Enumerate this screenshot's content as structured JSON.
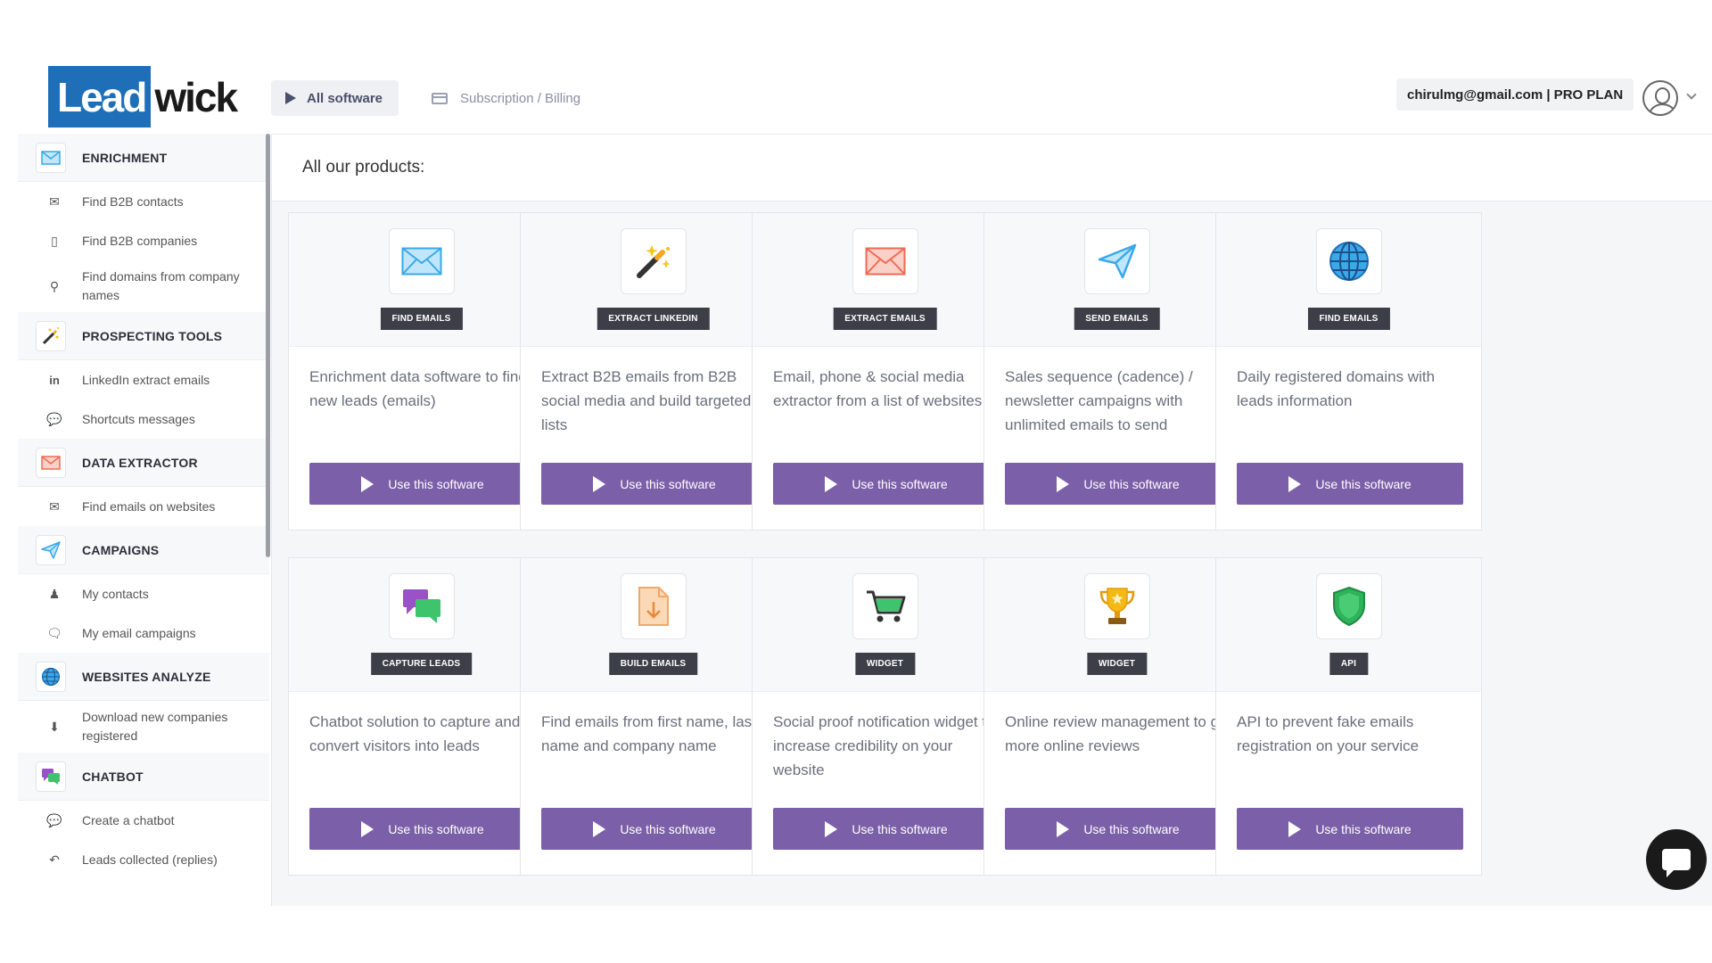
{
  "header": {
    "logo_part1": "Lead",
    "logo_part2": "wick",
    "nav_all_software": "All software",
    "nav_billing": "Subscription / Billing",
    "account_label": "chirulmg@gmail.com | PRO PLAN"
  },
  "sidebar": {
    "sections": [
      {
        "label": "ENRICHMENT",
        "icon": "envelope-icon",
        "items": [
          {
            "label": "Find B2B contacts",
            "icon": "mail-icon"
          },
          {
            "label": "Find B2B companies",
            "icon": "building-icon"
          },
          {
            "label": "Find domains from company names",
            "icon": "search-icon"
          }
        ]
      },
      {
        "label": "PROSPECTING TOOLS",
        "icon": "magic-wand-icon",
        "items": [
          {
            "label": "LinkedIn extract emails",
            "icon": "linkedin-icon"
          },
          {
            "label": "Shortcuts messages",
            "icon": "comment-icon"
          }
        ]
      },
      {
        "label": "DATA EXTRACTOR",
        "icon": "envelope-red-icon",
        "items": [
          {
            "label": "Find emails on websites",
            "icon": "mail-icon"
          }
        ]
      },
      {
        "label": "CAMPAIGNS",
        "icon": "paper-plane-icon",
        "items": [
          {
            "label": "My contacts",
            "icon": "users-icon"
          },
          {
            "label": "My email campaigns",
            "icon": "comments-icon"
          }
        ]
      },
      {
        "label": "WEBSITES ANALYZE",
        "icon": "globe-icon",
        "items": [
          {
            "label": "Download new companies registered",
            "icon": "download-icon"
          }
        ]
      },
      {
        "label": "CHATBOT",
        "icon": "chat-bubbles-icon",
        "items": [
          {
            "label": "Create a chatbot",
            "icon": "comment-icon"
          },
          {
            "label": "Leads collected (replies)",
            "icon": "reply-icon"
          }
        ]
      }
    ]
  },
  "main": {
    "title": "All our products:",
    "button_label": "Use this software",
    "products": [
      {
        "tag": "FIND EMAILS",
        "icon": "envelope-icon",
        "desc": "Enrichment data software to find new leads (emails)"
      },
      {
        "tag": "EXTRACT LINKEDIN",
        "icon": "magic-wand-icon",
        "desc": "Extract B2B emails from B2B social media and build targeted lists"
      },
      {
        "tag": "EXTRACT EMAILS",
        "icon": "envelope-red-icon",
        "desc": "Email, phone & social media extractor from a list of websites"
      },
      {
        "tag": "SEND EMAILS",
        "icon": "paper-plane-icon",
        "desc": "Sales sequence (cadence) / newsletter campaigns with unlimited emails to send"
      },
      {
        "tag": "FIND EMAILS",
        "icon": "globe-icon",
        "desc": "Daily registered domains with leads information"
      },
      {
        "tag": "CAPTURE LEADS",
        "icon": "chat-bubbles-icon",
        "desc": "Chatbot solution to capture and convert visitors into leads"
      },
      {
        "tag": "BUILD EMAILS",
        "icon": "document-download-icon",
        "desc": "Find emails from first name, last name and company name"
      },
      {
        "tag": "WIDGET",
        "icon": "shopping-cart-icon",
        "desc": "Social proof notification widget to increase credibility on your website"
      },
      {
        "tag": "WIDGET",
        "icon": "trophy-icon",
        "desc": "Online review management to get more online reviews"
      },
      {
        "tag": "API",
        "icon": "shield-icon",
        "desc": "API to prevent fake emails registration on your service"
      }
    ]
  },
  "colors": {
    "brand_blue": "#1e6fb8",
    "button_purple": "#7b5fa8",
    "tag_dark": "#3c3f48"
  }
}
